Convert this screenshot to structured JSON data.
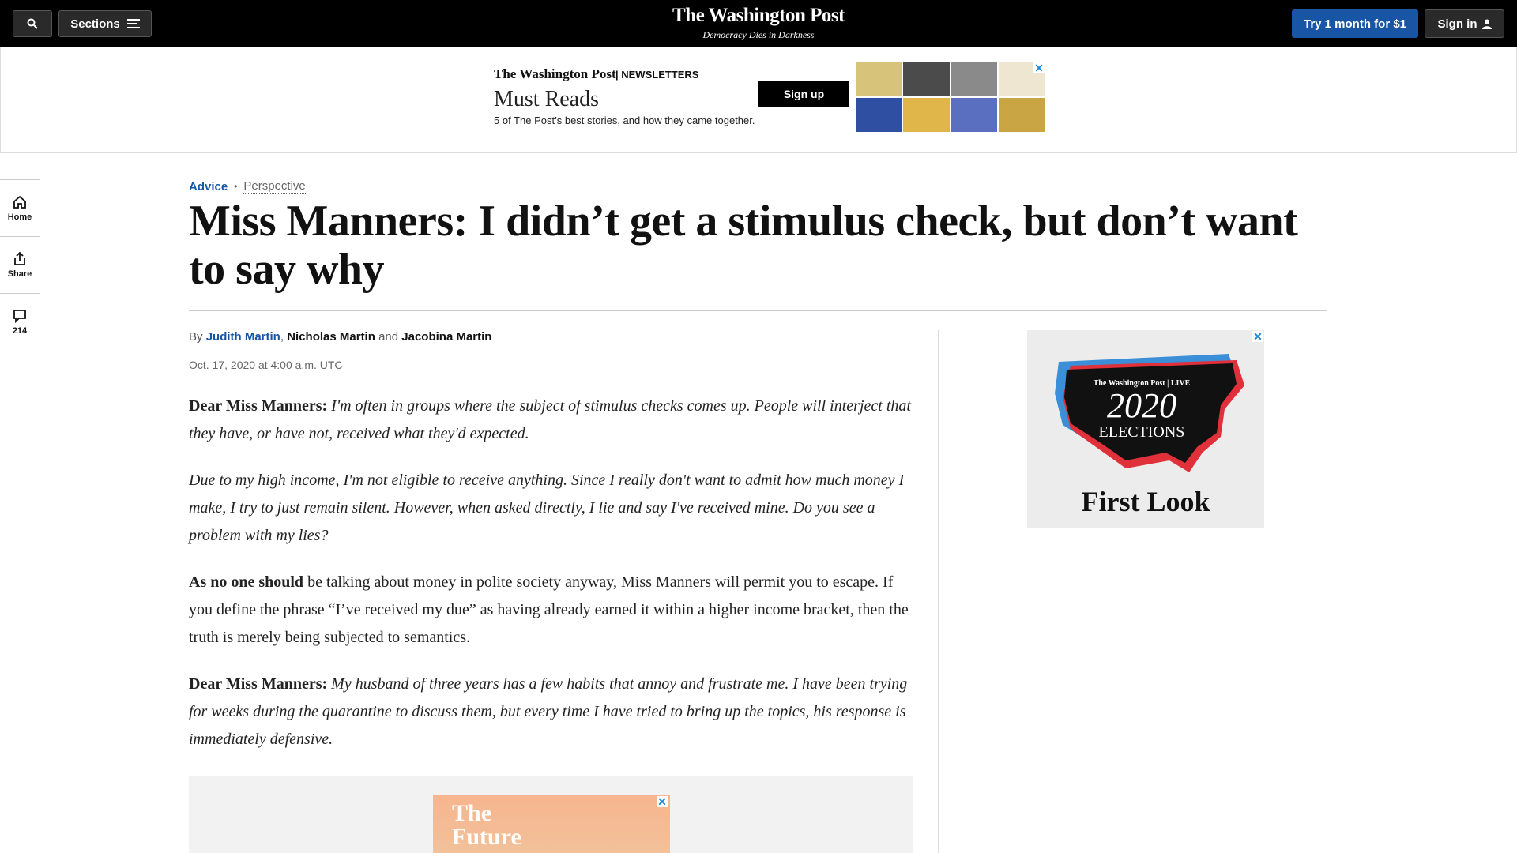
{
  "header": {
    "sections_label": "Sections",
    "logo": "The Washington Post",
    "tagline": "Democracy Dies in Darkness",
    "try_label": "Try 1 month for $1",
    "signin_label": "Sign in"
  },
  "top_ad": {
    "logo": "The Washington Post",
    "tag": "NEWSLETTERS",
    "title": "Must Reads",
    "description": "5 of The Post’s best stories, and how they came together.",
    "button": "Sign up",
    "close": "✕"
  },
  "rail": {
    "home_label": "Home",
    "share_label": "Share",
    "comments_count": "214"
  },
  "article": {
    "section": "Advice",
    "dot": "•",
    "label": "Perspective",
    "headline": "Miss Manners: I didn’t get a stimulus check, but don’t want to say why",
    "by": "By",
    "author1": "Judith Martin",
    "comma": ",",
    "author2": "Nicholas Martin",
    "and": "and",
    "author3": "Jacobina Martin",
    "date": "Oct. 17, 2020 at 4:00 a.m. UTC",
    "p1_lead": "Dear Miss Manners:",
    "p1_text": "I'm often in groups where the subject of stimulus checks comes up. People will interject that they have, or have not, received what they'd expected.",
    "p2_text": "Due to my high income, I'm not eligible to receive anything. Since I really don't want to admit how much money I make, I try to just remain silent. However, when asked directly, I lie and say I've received mine. Do you see a problem with my lies?",
    "p3_lead": "As no one should",
    "p3_text": "be talking about money in polite society anyway, Miss Manners will permit you to escape. If you define the phrase “I’ve received my due” as having already earned it within a higher income bracket, then the truth is merely being subjected to semantics.",
    "p4_lead": "Dear Miss Manners:",
    "p4_text": "My husband of three years has a few habits that annoy and frustrate me. I have been trying for weeks during the quarantine to discuss them, but every time I have tried to bring up the topics, his response is immediately defensive."
  },
  "right_ad": {
    "logo": "The Washington Post | LIVE",
    "year": "2020",
    "word": "ELECTIONS",
    "title": "First Look",
    "close": "✕"
  },
  "inline_ad": {
    "line1": "The",
    "line2": "Future",
    "close": "✕"
  }
}
